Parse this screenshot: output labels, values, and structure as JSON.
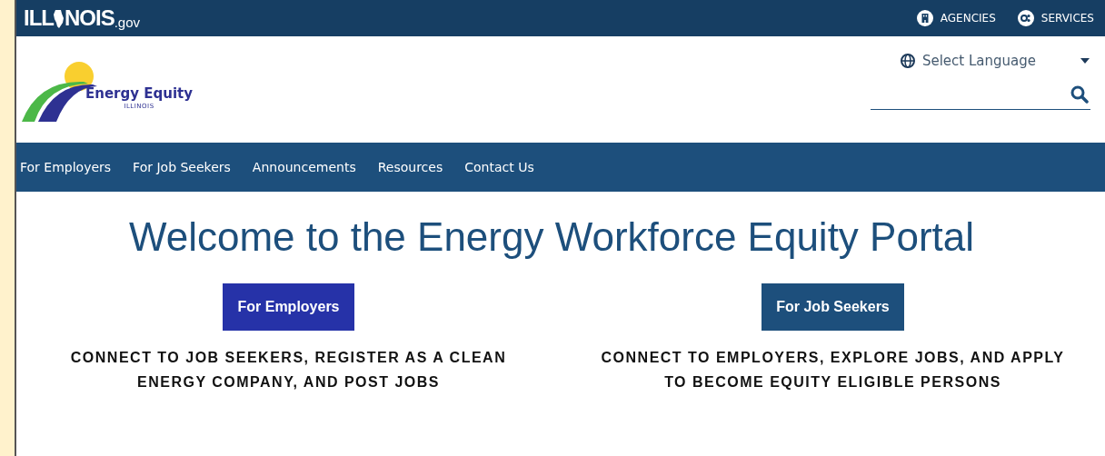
{
  "top_bar": {
    "brand_start": "ILL",
    "brand_end": "NOIS",
    "brand_suffix": ".gov",
    "links": [
      {
        "label": "AGENCIES",
        "kind": "building"
      },
      {
        "label": "SERVICES",
        "kind": "gears"
      }
    ]
  },
  "header": {
    "logo": {
      "name": "Energy Equity",
      "subtitle": "ILLINOIS"
    },
    "language": {
      "label": "Select Language"
    }
  },
  "nav": [
    {
      "label": "For Employers"
    },
    {
      "label": "For Job Seekers"
    },
    {
      "label": "Announcements"
    },
    {
      "label": "Resources"
    },
    {
      "label": "Contact Us"
    }
  ],
  "main": {
    "heading": "Welcome to the Energy Workforce Equity Portal",
    "columns": [
      {
        "button": "For Employers",
        "color": "#2632a8",
        "text": "CONNECT TO JOB SEEKERS, REGISTER AS A CLEAN ENERGY COMPANY, AND POST JOBS"
      },
      {
        "button": "For Job Seekers",
        "color": "#1d4f7c",
        "text": "CONNECT TO EMPLOYERS, EXPLORE JOBS, AND APPLY TO BECOME EQUITY ELIGIBLE PERSONS"
      }
    ]
  }
}
